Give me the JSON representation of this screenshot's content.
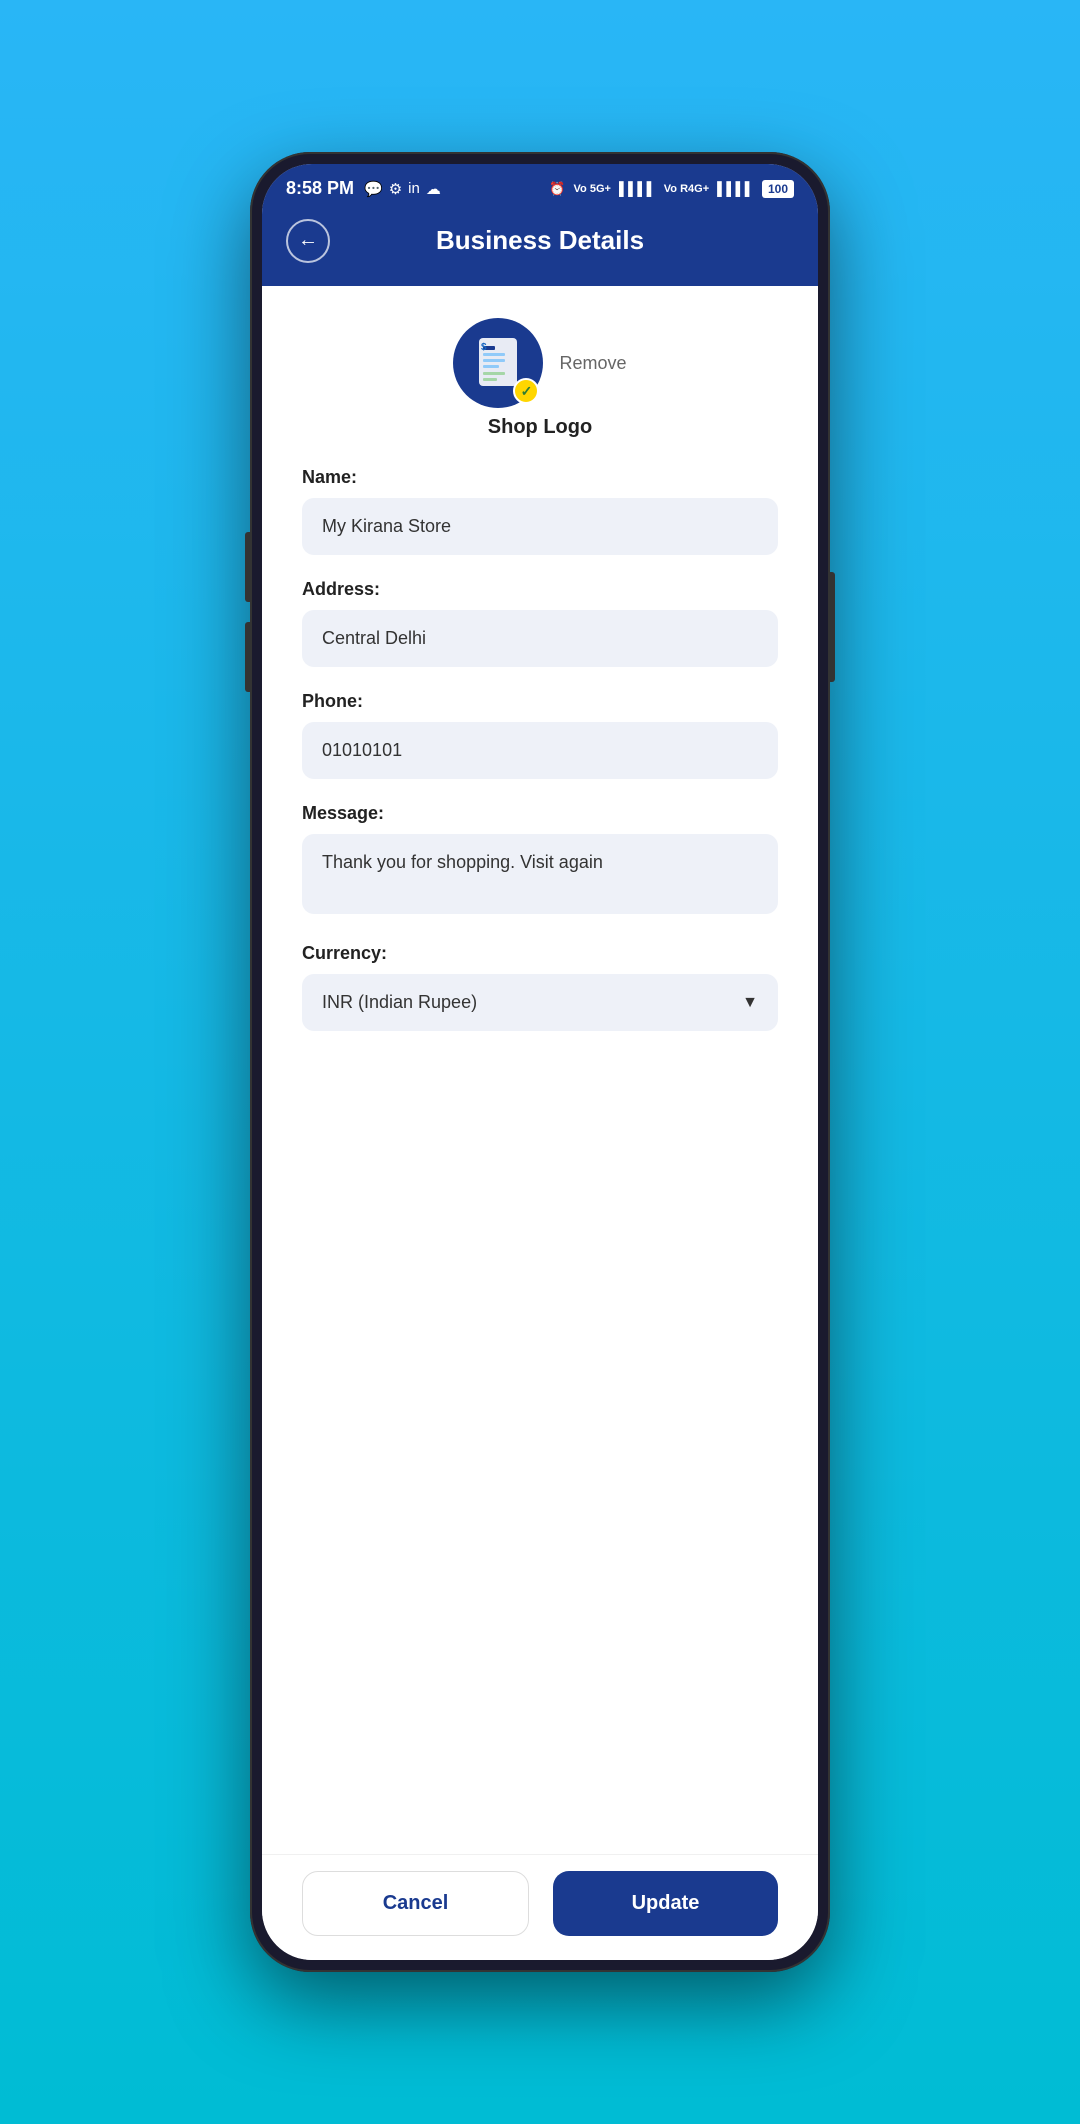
{
  "statusBar": {
    "time": "8:58 PM",
    "batteryLabel": "100"
  },
  "header": {
    "title": "Business Details",
    "backLabel": "←"
  },
  "logo": {
    "label": "Shop Logo",
    "removeLabel": "Remove"
  },
  "form": {
    "nameLabelText": "Name:",
    "nameValue": "My Kirana Store",
    "addressLabelText": "Address:",
    "addressValue": "Central Delhi",
    "phoneLabelText": "Phone:",
    "phoneValue": "01010101",
    "messageLabelText": "Message:",
    "messageValue": "Thank you for shopping. Visit again",
    "currencyLabelText": "Currency:",
    "currencyValue": "INR (Indian Rupee)"
  },
  "buttons": {
    "cancelLabel": "Cancel",
    "updateLabel": "Update"
  }
}
